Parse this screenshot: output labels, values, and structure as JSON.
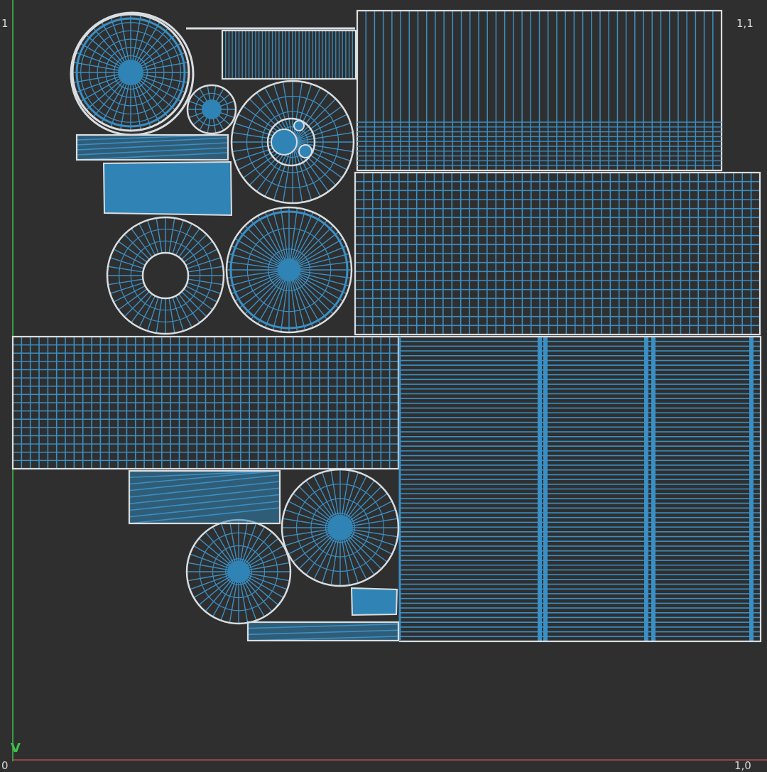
{
  "editor": {
    "labels": {
      "top_left": "1",
      "top_right": "1,1",
      "bottom_left": "0",
      "bottom_right": "1,0",
      "v_axis": "V"
    },
    "colors": {
      "background": "#2f2f2f",
      "island_outline": "#d9dde0",
      "wire": "#3a8fc4",
      "fill": "#2f84b5",
      "v_axis": "#3fbf4a",
      "u_axis": "#b84a4a"
    },
    "uv_islands": [
      {
        "name": "large-disc",
        "shape": "circle"
      },
      {
        "name": "thin-strip",
        "shape": "strip"
      },
      {
        "name": "small-disc",
        "shape": "circle"
      },
      {
        "name": "disc-with-holes",
        "shape": "circle"
      },
      {
        "name": "flat-bar",
        "shape": "strip"
      },
      {
        "name": "solid-quad",
        "shape": "quad"
      },
      {
        "name": "ring",
        "shape": "ring"
      },
      {
        "name": "radial-disc",
        "shape": "circle"
      },
      {
        "name": "top-tall-grid",
        "shape": "grid"
      },
      {
        "name": "top-dense-grid",
        "shape": "grid"
      },
      {
        "name": "left-grid",
        "shape": "grid"
      },
      {
        "name": "large-ribbed-panel",
        "shape": "grid"
      },
      {
        "name": "hatched-strip",
        "shape": "strip"
      },
      {
        "name": "lower-disc-right",
        "shape": "circle"
      },
      {
        "name": "lower-disc-left",
        "shape": "circle"
      },
      {
        "name": "small-quad",
        "shape": "quad"
      },
      {
        "name": "bottom-strip",
        "shape": "strip"
      }
    ]
  }
}
